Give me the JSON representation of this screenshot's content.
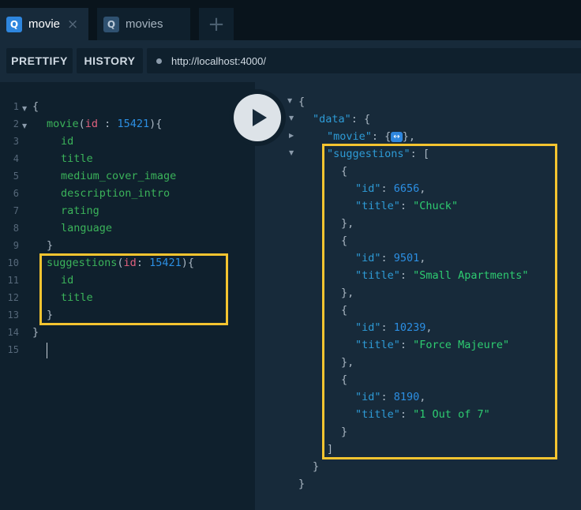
{
  "tabs": [
    {
      "badge": "Q",
      "label": "movie",
      "close": "×",
      "active": true
    },
    {
      "badge": "Q",
      "label": "movies",
      "active": false
    }
  ],
  "add_tab_symbol": "+",
  "toolbar": {
    "prettify_label": "PRETTIFY",
    "history_label": "HISTORY",
    "url": "http://localhost:4000/"
  },
  "editor": {
    "line_numbers": [
      "1",
      "2",
      "3",
      "4",
      "5",
      "6",
      "7",
      "8",
      "9",
      "10",
      "11",
      "12",
      "13",
      "14",
      "15"
    ],
    "movie_call": "movie",
    "movie_arg": "id",
    "movie_sep": " : ",
    "movie_id": "15421",
    "movie_fields": [
      "id",
      "title",
      "medium_cover_image",
      "description_intro",
      "rating",
      "language"
    ],
    "suggestions_call": "suggestions",
    "suggestions_arg": "id",
    "suggestions_sep": ": ",
    "suggestions_id": "15421",
    "suggestions_fields": [
      "id",
      "title"
    ]
  },
  "result": {
    "data_key": "\"data\"",
    "movie_key": "\"movie\"",
    "collapsed_symbol": "↔",
    "suggestions_key": "\"suggestions\"",
    "id_key": "\"id\"",
    "title_key": "\"title\"",
    "suggestions": [
      {
        "id": "6656",
        "title": "\"Chuck\""
      },
      {
        "id": "9501",
        "title": "\"Small Apartments\""
      },
      {
        "id": "10239",
        "title": "\"Force Majeure\""
      },
      {
        "id": "8190",
        "title": "\"1 Out of 7\""
      }
    ]
  },
  "colors": {
    "highlight_box": "#f4c430",
    "field": "#3bb35a",
    "number": "#2c8fe3",
    "argument": "#e0607e",
    "string": "#2ecc71"
  }
}
